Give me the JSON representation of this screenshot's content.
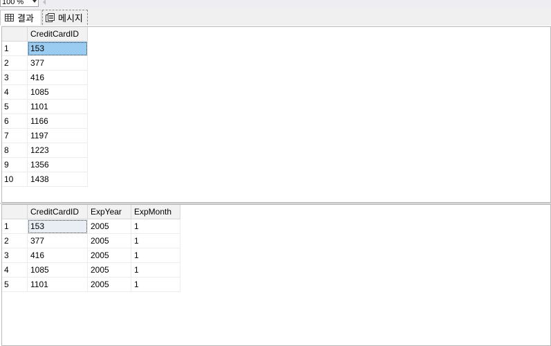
{
  "toolbar": {
    "zoom_value": "100 %"
  },
  "tabs": {
    "results_label": "결과",
    "messages_label": "메시지"
  },
  "grid1": {
    "columns": [
      "CreditCardID"
    ],
    "rows": [
      {
        "num": "1",
        "cells": [
          "153"
        ]
      },
      {
        "num": "2",
        "cells": [
          "377"
        ]
      },
      {
        "num": "3",
        "cells": [
          "416"
        ]
      },
      {
        "num": "4",
        "cells": [
          "1085"
        ]
      },
      {
        "num": "5",
        "cells": [
          "1101"
        ]
      },
      {
        "num": "6",
        "cells": [
          "1166"
        ]
      },
      {
        "num": "7",
        "cells": [
          "1197"
        ]
      },
      {
        "num": "8",
        "cells": [
          "1223"
        ]
      },
      {
        "num": "9",
        "cells": [
          "1356"
        ]
      },
      {
        "num": "10",
        "cells": [
          "1438"
        ]
      }
    ]
  },
  "grid2": {
    "columns": [
      "CreditCardID",
      "ExpYear",
      "ExpMonth"
    ],
    "rows": [
      {
        "num": "1",
        "cells": [
          "153",
          "2005",
          "1"
        ]
      },
      {
        "num": "2",
        "cells": [
          "377",
          "2005",
          "1"
        ]
      },
      {
        "num": "3",
        "cells": [
          "416",
          "2005",
          "1"
        ]
      },
      {
        "num": "4",
        "cells": [
          "1085",
          "2005",
          "1"
        ]
      },
      {
        "num": "5",
        "cells": [
          "1101",
          "2005",
          "1"
        ]
      }
    ]
  },
  "colors": {
    "selected_cell": "#99ccf0",
    "focused_cell": "#e8eef4",
    "header_bg": "#f2f2f2"
  }
}
